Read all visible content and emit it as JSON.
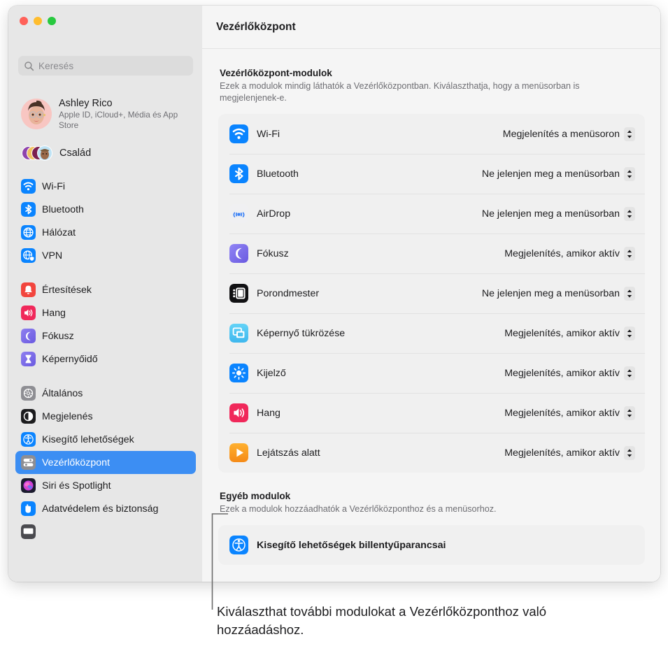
{
  "window": {
    "traffic_lights": [
      "close",
      "minimize",
      "zoom"
    ],
    "colors": {
      "accent_blue": "#3c8ef3",
      "sidebar_bg": "#e7e7e7",
      "content_bg": "#f5f5f5",
      "card_bg": "#f0f0f0",
      "red": "#ff6159",
      "yellow": "#ffbd2e",
      "green": "#28c93f"
    }
  },
  "sidebar": {
    "search": {
      "placeholder": "Keresés",
      "value": "",
      "icon": "search-icon"
    },
    "account": {
      "name": "Ashley Rico",
      "subtitle": "Apple ID, iCloud+, Média és App Store",
      "avatar": "memoji-avatar"
    },
    "family": {
      "label": "Család",
      "icon": "family-avatars-icon"
    },
    "groups": [
      {
        "items": [
          {
            "label": "Wi-Fi",
            "icon": "wifi-icon",
            "selected": false
          },
          {
            "label": "Bluetooth",
            "icon": "bluetooth-icon",
            "selected": false
          },
          {
            "label": "Hálózat",
            "icon": "network-globe-icon",
            "selected": false
          },
          {
            "label": "VPN",
            "icon": "vpn-globe-icon",
            "selected": false
          }
        ]
      },
      {
        "items": [
          {
            "label": "Értesítések",
            "icon": "notifications-bell-icon",
            "selected": false
          },
          {
            "label": "Hang",
            "icon": "sound-speaker-icon",
            "selected": false
          },
          {
            "label": "Fókusz",
            "icon": "focus-moon-icon",
            "selected": false
          },
          {
            "label": "Képernyőidő",
            "icon": "screen-time-hourglass-icon",
            "selected": false
          }
        ]
      },
      {
        "items": [
          {
            "label": "Általános",
            "icon": "general-gear-icon",
            "selected": false
          },
          {
            "label": "Megjelenés",
            "icon": "appearance-icon",
            "selected": false
          },
          {
            "label": "Kisegítő lehetőségek",
            "icon": "accessibility-icon",
            "selected": false
          },
          {
            "label": "Vezérlőközpont",
            "icon": "control-center-icon",
            "selected": true
          },
          {
            "label": "Siri és Spotlight",
            "icon": "siri-icon",
            "selected": false
          },
          {
            "label": "Adatvédelem és biztonság",
            "icon": "privacy-hand-icon",
            "selected": false
          }
        ]
      }
    ]
  },
  "main": {
    "title": "Vezérlőközpont",
    "sections": [
      {
        "title": "Vezérlőközpont-modulok",
        "description": "Ezek a modulok mindig láthatók a Vezérlőközpontban. Kiválaszthatja, hogy a menüsorban is megjelenjenek-e.",
        "rows": [
          {
            "label": "Wi-Fi",
            "icon": "wifi-icon",
            "value": "Megjelenítés a menüsoron"
          },
          {
            "label": "Bluetooth",
            "icon": "bluetooth-icon",
            "value": "Ne jelenjen meg a menüsorban"
          },
          {
            "label": "AirDrop",
            "icon": "airdrop-icon",
            "value": "Ne jelenjen meg a menüsorban"
          },
          {
            "label": "Fókusz",
            "icon": "focus-moon-icon",
            "value": "Megjelenítés, amikor aktív"
          },
          {
            "label": "Porondmester",
            "icon": "stage-manager-icon",
            "value": "Ne jelenjen meg a menüsorban"
          },
          {
            "label": "Képernyő tükrözése",
            "icon": "screen-mirroring-icon",
            "value": "Megjelenítés, amikor aktív"
          },
          {
            "label": "Kijelző",
            "icon": "display-brightness-icon",
            "value": "Megjelenítés, amikor aktív"
          },
          {
            "label": "Hang",
            "icon": "sound-speaker-icon",
            "value": "Megjelenítés, amikor aktív"
          },
          {
            "label": "Lejátszás alatt",
            "icon": "now-playing-icon",
            "value": "Megjelenítés, amikor aktív"
          }
        ]
      },
      {
        "title": "Egyéb modulok",
        "description": "Ezek a modulok hozzáadhatók a Vezérlőközponthoz és a menüsorhoz.",
        "rows": [
          {
            "label": "Kisegítő lehetőségek billentyűparancsai",
            "icon": "accessibility-icon",
            "value": ""
          }
        ]
      }
    ]
  },
  "callout": {
    "text": "Kiválaszthat további modulokat a Vezérlőközponthoz való hozzáadáshoz."
  }
}
